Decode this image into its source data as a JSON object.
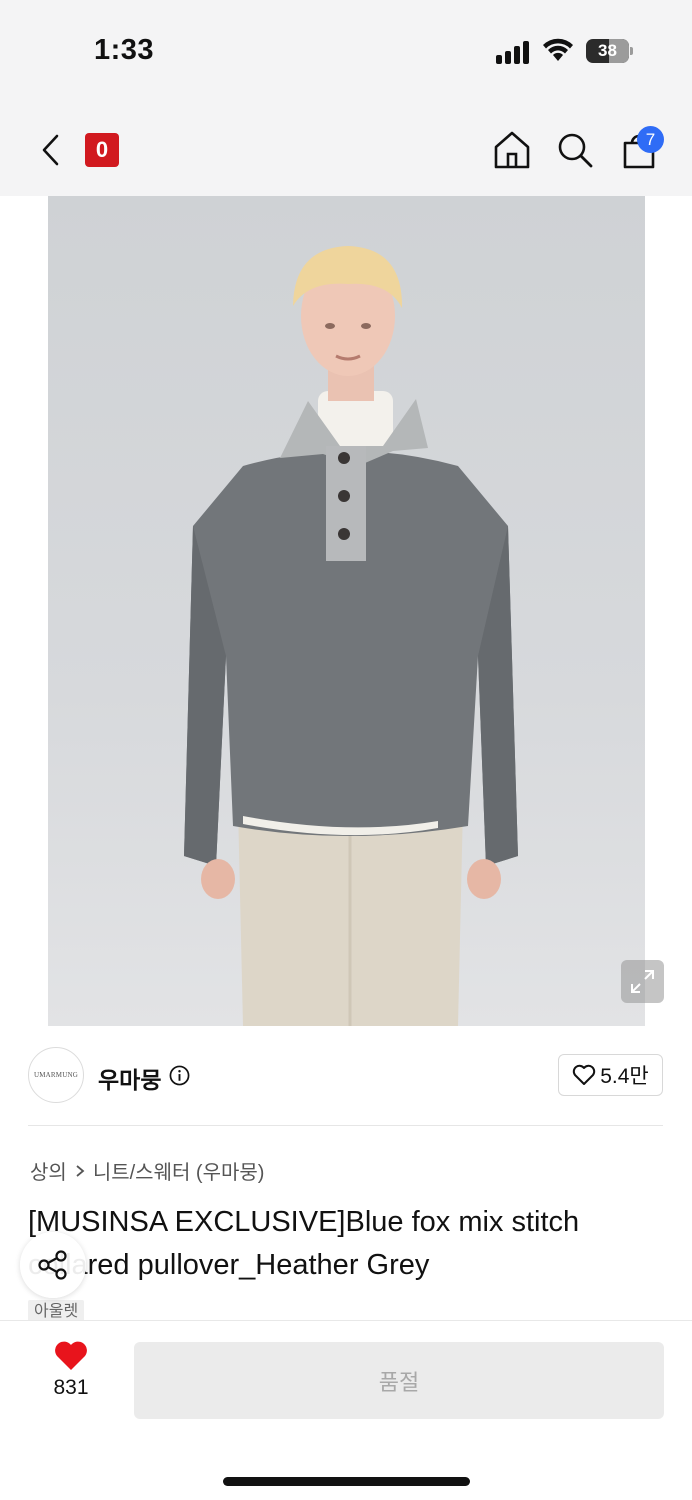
{
  "status": {
    "time": "1:33",
    "battery": "38"
  },
  "nav": {
    "logo_label": "0",
    "cart_count": "7",
    "icons": [
      "back-icon",
      "home-icon",
      "search-icon",
      "cart-icon"
    ]
  },
  "brand": {
    "logo_text": "UMARMUNG",
    "name": "우마뭉",
    "likes": "5.4만"
  },
  "breadcrumb": {
    "level1": "상의",
    "level2": "니트/스웨터 (우마뭉)"
  },
  "product": {
    "title": "[MUSINSA EXCLUSIVE]Blue fox mix stitch collared pullover_Heather Grey",
    "tag": "아울렛"
  },
  "bottom": {
    "heart_count": "831",
    "buy_label": "품절"
  },
  "colors": {
    "accent_red": "#d1191f",
    "cart_badge": "#2f6cf6",
    "heart": "#e8141c"
  }
}
